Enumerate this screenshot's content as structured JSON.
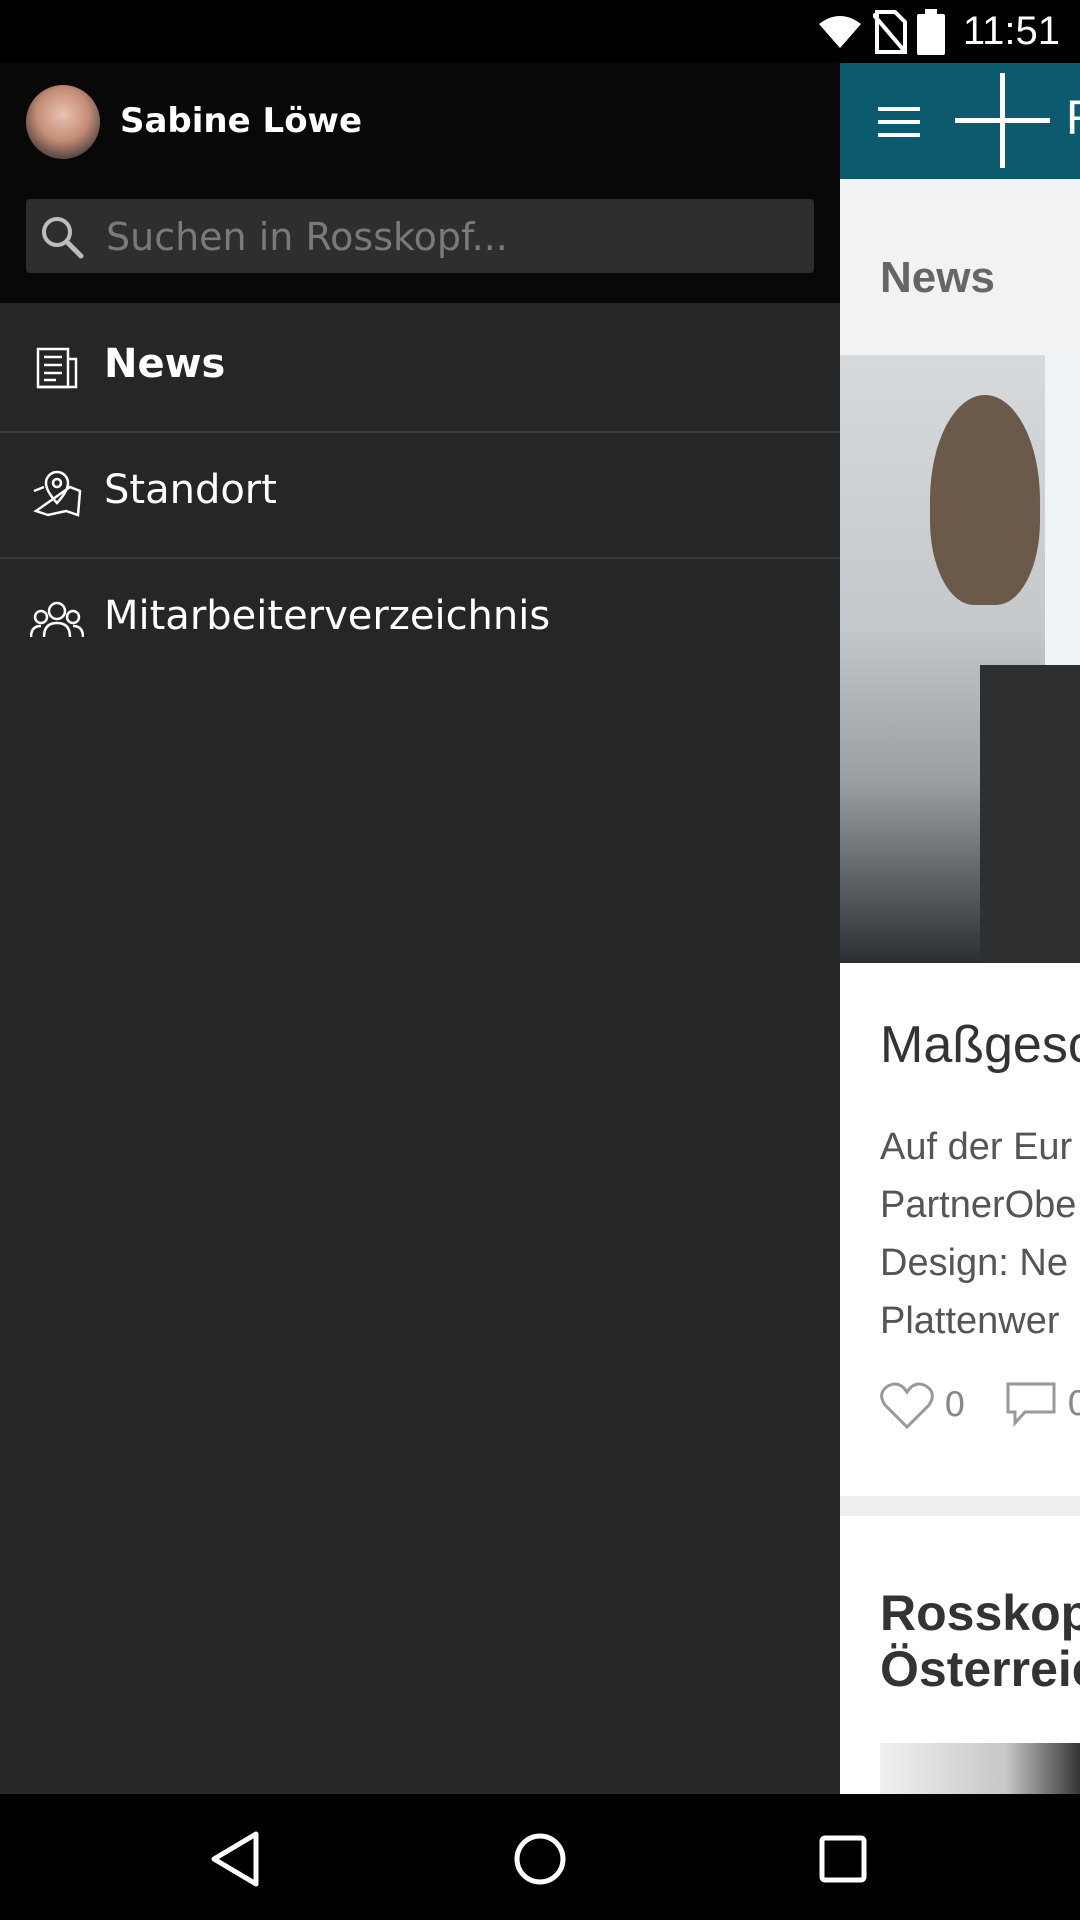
{
  "status_bar": {
    "time": "11:51"
  },
  "drawer": {
    "user_name": "Sabine Löwe",
    "search": {
      "placeholder": "Suchen in Rosskopf..."
    },
    "items": [
      {
        "label": "News",
        "icon": "newspaper-icon",
        "active": true
      },
      {
        "label": "Standort",
        "icon": "map-pin-icon",
        "active": false
      },
      {
        "label": "Mitarbeiterverzeichnis",
        "icon": "people-icon",
        "active": false
      }
    ]
  },
  "app": {
    "toolbar_title_partial": "R",
    "section_title": "News",
    "article1": {
      "title_partial": "Maßgesc",
      "text_lines": [
        "Auf der Eur",
        "PartnerObe",
        "Design: Ne",
        "Plattenwer"
      ],
      "likes": "0",
      "comments": "0"
    },
    "article2": {
      "title_lines": [
        "Rosskop",
        "Österreic"
      ]
    }
  },
  "colors": {
    "toolbar": "#0b5a6e",
    "drawer_bg": "#262626",
    "drawer_header_bg": "#080808"
  }
}
